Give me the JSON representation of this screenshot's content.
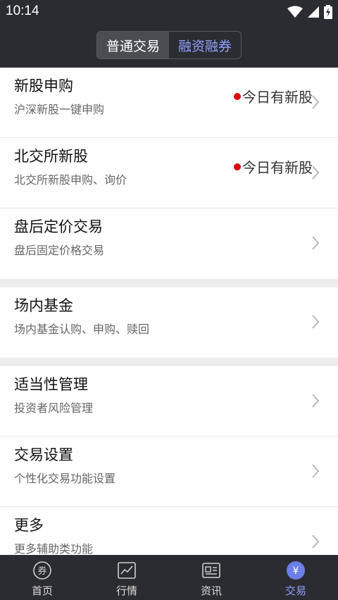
{
  "status": {
    "time": "10:14"
  },
  "segmented": {
    "normal": "普通交易",
    "margin": "融资融券"
  },
  "rows": [
    {
      "title": "新股申购",
      "subtitle": "沪深新股一键申购",
      "badge": "今日有新股"
    },
    {
      "title": "北交所新股",
      "subtitle": "北交所新股申购、询价",
      "badge": "今日有新股"
    },
    {
      "title": "盘后定价交易",
      "subtitle": "盘后固定价格交易"
    },
    {
      "title": "场内基金",
      "subtitle": "场内基金认购、申购、赎回"
    },
    {
      "title": "适当性管理",
      "subtitle": "投资者风险管理"
    },
    {
      "title": "交易设置",
      "subtitle": "个性化交易功能设置"
    },
    {
      "title": "更多",
      "subtitle": "更多辅助类功能"
    }
  ],
  "tabs": [
    {
      "label": "首页",
      "icon": "coupon-icon"
    },
    {
      "label": "行情",
      "icon": "chart-icon"
    },
    {
      "label": "资讯",
      "icon": "news-icon"
    },
    {
      "label": "交易",
      "icon": "yen-icon"
    }
  ],
  "colors": {
    "header": "#2b2c31",
    "accent": "#8ea0ff",
    "badge_dot": "#e00000"
  }
}
